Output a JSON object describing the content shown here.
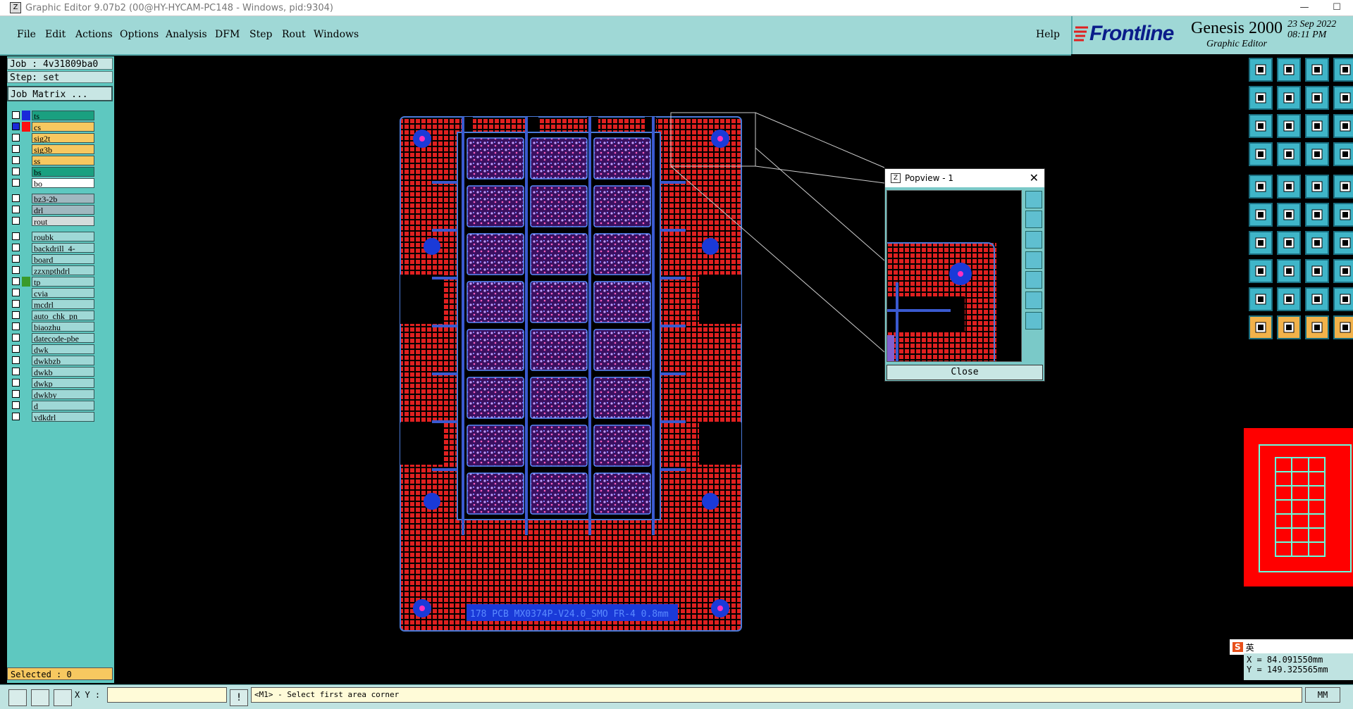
{
  "window": {
    "title": "Graphic Editor 9.07b2 (00@HY-HYCAM-PC148 - Windows, pid:9304)",
    "minimize": "—",
    "maximize": "☐",
    "close": "✕"
  },
  "menu": {
    "file": "File",
    "edit": "Edit",
    "actions": "Actions",
    "options": "Options",
    "analysis": "Analysis",
    "dfm": "DFM",
    "step": "Step",
    "rout": "Rout",
    "windows": "Windows",
    "help": "Help"
  },
  "brand": {
    "logo": "Frontline",
    "product": "Genesis 2000",
    "subtitle": "Graphic Editor",
    "date": "23 Sep 2022",
    "time": "08:11 PM"
  },
  "job": {
    "job_label": "Job : 4v31809ba0",
    "step_label": "Step: set",
    "matrix_button": "Job Matrix ..."
  },
  "layers": [
    {
      "name": "ts",
      "bg": "#1aa080",
      "swatch": "#1a2ad8"
    },
    {
      "name": "cs",
      "bg": "#f7c860",
      "swatch": "#ff1010",
      "active": true
    },
    {
      "name": "sig2t",
      "bg": "#f7c860",
      "swatch": ""
    },
    {
      "name": "sig3b",
      "bg": "#f7c860",
      "swatch": ""
    },
    {
      "name": "ss",
      "bg": "#f7c860",
      "swatch": ""
    },
    {
      "name": "bs",
      "bg": "#1aa080",
      "swatch": ""
    },
    {
      "name": "bo",
      "bg": "#ffffff",
      "swatch": ""
    },
    {
      "name": "bz3-2b",
      "bg": "#a0b8c0",
      "swatch": "",
      "gap": true
    },
    {
      "name": "drl",
      "bg": "#a0b8c0",
      "swatch": ""
    },
    {
      "name": "rout",
      "bg": "#d4dcdc",
      "swatch": ""
    },
    {
      "name": "roubk",
      "bg": "#9fd8d6",
      "swatch": "",
      "gap": true
    },
    {
      "name": "backdrill_4-",
      "bg": "#9fd8d6",
      "swatch": ""
    },
    {
      "name": "board",
      "bg": "#9fd8d6",
      "swatch": ""
    },
    {
      "name": "zzxnpthdrl",
      "bg": "#9fd8d6",
      "swatch": ""
    },
    {
      "name": "tp",
      "bg": "#9fd8d6",
      "swatch": "#3a9a2a"
    },
    {
      "name": "cvia",
      "bg": "#9fd8d6",
      "swatch": ""
    },
    {
      "name": "mcdrl",
      "bg": "#9fd8d6",
      "swatch": ""
    },
    {
      "name": "auto_chk_pn",
      "bg": "#9fd8d6",
      "swatch": ""
    },
    {
      "name": "biaozhu",
      "bg": "#9fd8d6",
      "swatch": ""
    },
    {
      "name": "datecode-pbe",
      "bg": "#9fd8d6",
      "swatch": ""
    },
    {
      "name": "dwk",
      "bg": "#9fd8d6",
      "swatch": ""
    },
    {
      "name": "dwkbzb",
      "bg": "#9fd8d6",
      "swatch": ""
    },
    {
      "name": "dwkb",
      "bg": "#9fd8d6",
      "swatch": ""
    },
    {
      "name": "dwkp",
      "bg": "#9fd8d6",
      "swatch": ""
    },
    {
      "name": "dwkby",
      "bg": "#9fd8d6",
      "swatch": ""
    },
    {
      "name": "d",
      "bg": "#9fd8d6",
      "swatch": ""
    },
    {
      "name": "ydkdrl",
      "bg": "#9fd8d6",
      "swatch": ""
    }
  ],
  "selected_label": "Selected : 0",
  "status": {
    "xy_label": "X Y :",
    "xy_value": "",
    "exclaim": "!",
    "message": "<M1> - Select first area corner",
    "units": "MM"
  },
  "coords": {
    "x": "X = 84.091550mm",
    "y": "Y = 149.325565mm"
  },
  "board_text": "178 PCB MX0374P-V24.0_SMO FR-4 0.8mm",
  "popview": {
    "title": "Popview - 1",
    "close_x": "✕",
    "close_button": "Close"
  },
  "ime": {
    "label": "英"
  },
  "colors": {
    "copper": "#e02020",
    "pad_blue": "#1a3ad8",
    "outline": "#4a7ad8",
    "panel_teal": "#9fd8d6"
  }
}
